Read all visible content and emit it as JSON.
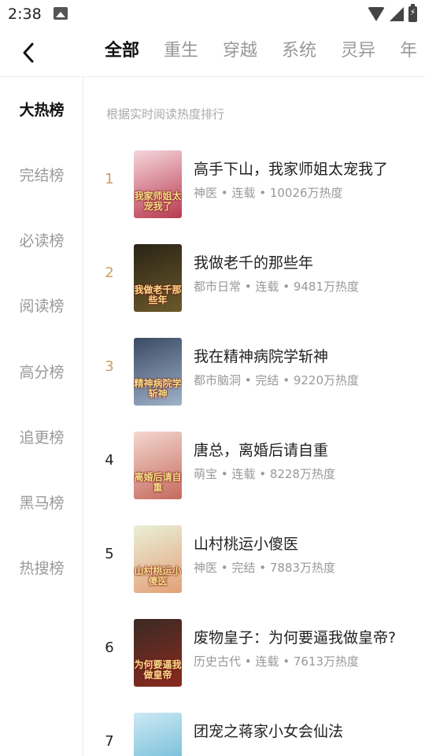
{
  "status_bar": {
    "time": "2:38"
  },
  "tabs": [
    {
      "label": "全部",
      "active": true
    },
    {
      "label": "重生",
      "active": false
    },
    {
      "label": "穿越",
      "active": false
    },
    {
      "label": "系统",
      "active": false
    },
    {
      "label": "灵异",
      "active": false
    },
    {
      "label": "年",
      "active": false
    }
  ],
  "sidebar": {
    "items": [
      {
        "label": "大热榜",
        "active": true
      },
      {
        "label": "完结榜",
        "active": false
      },
      {
        "label": "必读榜",
        "active": false
      },
      {
        "label": "阅读榜",
        "active": false
      },
      {
        "label": "高分榜",
        "active": false
      },
      {
        "label": "追更榜",
        "active": false
      },
      {
        "label": "黑马榜",
        "active": false
      },
      {
        "label": "热搜榜",
        "active": false
      }
    ]
  },
  "main": {
    "subtitle": "根据实时阅读热度排行",
    "books": [
      {
        "rank": "1",
        "title": "高手下山，我家师姐太宠我了",
        "genre": "神医",
        "status": "连载",
        "heat": "10026万热度",
        "cover_text": "我家师姐太宠我了"
      },
      {
        "rank": "2",
        "title": "我做老千的那些年",
        "genre": "都市日常",
        "status": "连载",
        "heat": "9481万热度",
        "cover_text": "我做老千那些年"
      },
      {
        "rank": "3",
        "title": "我在精神病院学斩神",
        "genre": "都市脑洞",
        "status": "完结",
        "heat": "9220万热度",
        "cover_text": "精神病院学斩神"
      },
      {
        "rank": "4",
        "title": "唐总，离婚后请自重",
        "genre": "萌宝",
        "status": "连载",
        "heat": "8228万热度",
        "cover_text": "离婚后请自重"
      },
      {
        "rank": "5",
        "title": "山村桃运小傻医",
        "genre": "神医",
        "status": "完结",
        "heat": "7883万热度",
        "cover_text": "山村桃运小傻医"
      },
      {
        "rank": "6",
        "title": "废物皇子：为何要逼我做皇帝?",
        "genre": "历史古代",
        "status": "连载",
        "heat": "7613万热度",
        "cover_text": "为何要逼我做皇帝"
      },
      {
        "rank": "7",
        "title": "团宠之蒋家小女会仙法",
        "genre": "",
        "status": "",
        "heat": "",
        "cover_text": ""
      }
    ]
  },
  "colors": {
    "top_rank": "#c9a062",
    "covers": [
      [
        "#f6d6dc",
        "#b83a4f"
      ],
      [
        "#2a2416",
        "#6b5a2c"
      ],
      [
        "#3a4a63",
        "#9fb2c9"
      ],
      [
        "#f3d7cf",
        "#c66a5e"
      ],
      [
        "#e9f0d8",
        "#e3a077"
      ],
      [
        "#3b2a24",
        "#8a2a1f"
      ],
      [
        "#cde9f3",
        "#5eb3d1"
      ]
    ]
  }
}
